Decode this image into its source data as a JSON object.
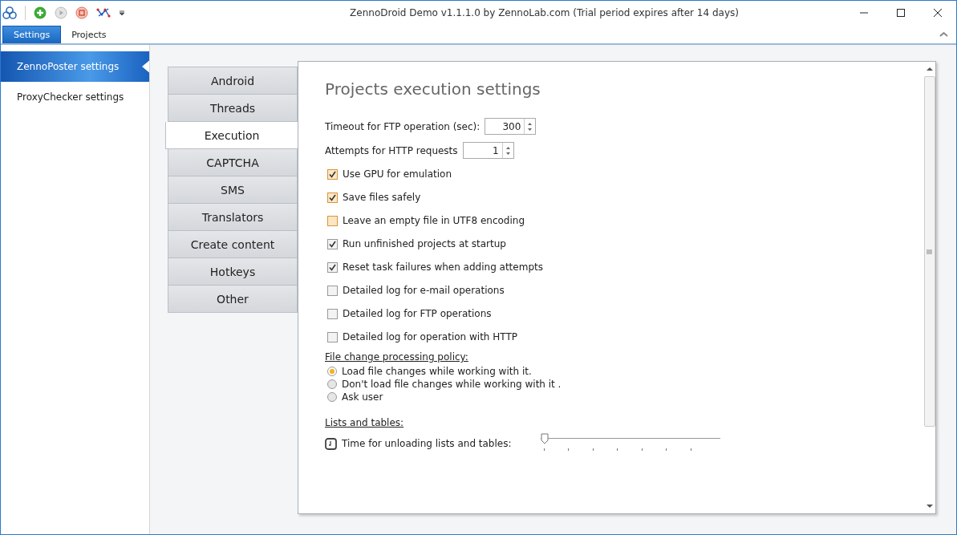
{
  "window": {
    "title": "ZennoDroid Demo v1.1.1.0 by ZennoLab.com (Trial period expires after 14 days)"
  },
  "ribbon_tabs": [
    {
      "label": "Settings",
      "selected": true
    },
    {
      "label": "Projects",
      "selected": false
    }
  ],
  "sidebar": {
    "items": [
      {
        "label": "ZennoPoster settings",
        "selected": true
      },
      {
        "label": "ProxyChecker settings",
        "selected": false
      }
    ]
  },
  "section_tabs": [
    {
      "label": "Android",
      "selected": false
    },
    {
      "label": "Threads",
      "selected": false
    },
    {
      "label": "Execution",
      "selected": true
    },
    {
      "label": "CAPTCHA",
      "selected": false
    },
    {
      "label": "SMS",
      "selected": false
    },
    {
      "label": "Translators",
      "selected": false
    },
    {
      "label": "Create content",
      "selected": false
    },
    {
      "label": "Hotkeys",
      "selected": false
    },
    {
      "label": "Other",
      "selected": false
    }
  ],
  "panel": {
    "title": "Projects execution settings",
    "spinners": [
      {
        "label": "Timeout for FTP operation (sec):",
        "value": "300"
      },
      {
        "label": "Attempts for HTTP requests",
        "value": "1"
      }
    ],
    "checkboxes": [
      {
        "label": "Use GPU for emulation",
        "checked": true,
        "kind": "accented"
      },
      {
        "label": "Save files safely",
        "checked": true,
        "kind": "accented"
      },
      {
        "label": "Leave an empty file in UTF8 encoding",
        "checked": false,
        "kind": "accented"
      },
      {
        "label": "Run unfinished projects at startup",
        "checked": true,
        "kind": "plain"
      },
      {
        "label": "Reset task failures when adding attempts",
        "checked": true,
        "kind": "plain"
      },
      {
        "label": "Detailed log for e-mail operations",
        "checked": false,
        "kind": "plain"
      },
      {
        "label": "Detailed log for FTP operations",
        "checked": false,
        "kind": "plain"
      },
      {
        "label": "Detailed log for operation with HTTP",
        "checked": false,
        "kind": "plain"
      }
    ],
    "policy_heading": "File change processing policy:",
    "policy_options": [
      {
        "label": "Load file changes while working with it.",
        "selected": true
      },
      {
        "label": "Don't load file changes while working with it .",
        "selected": false
      },
      {
        "label": "Ask user",
        "selected": false
      }
    ],
    "lists_heading": "Lists and tables:",
    "slider": {
      "label": "Time for unloading lists and tables:",
      "level": 0
    }
  }
}
